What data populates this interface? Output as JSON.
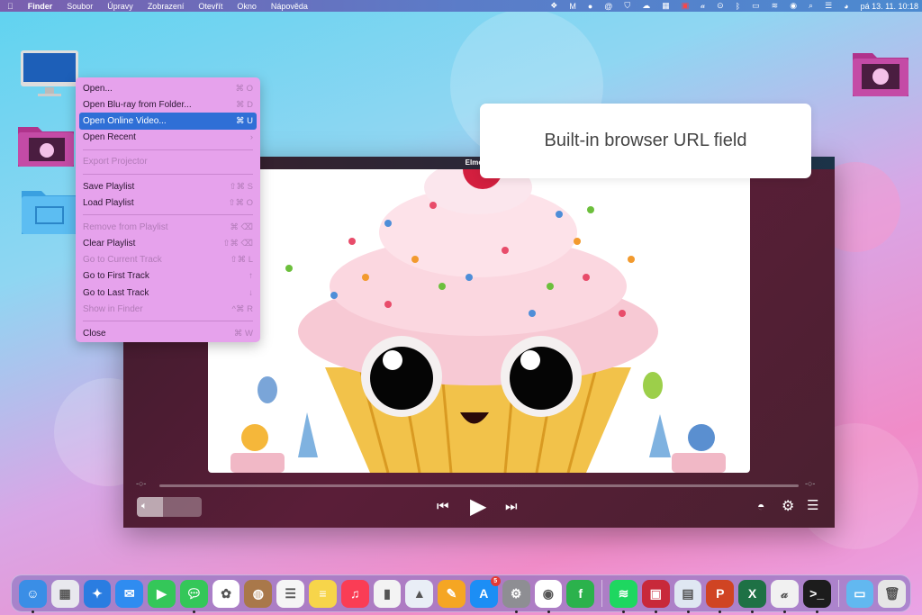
{
  "menubar": {
    "apple": "",
    "items": [
      "Finder",
      "Soubor",
      "Úpravy",
      "Zobrazení",
      "Otevřít",
      "Okno",
      "Nápověda"
    ],
    "clock": "pá 13. 11.  10:18"
  },
  "context_menu": {
    "items": [
      {
        "label": "Open...",
        "shortcut": "⌘ O",
        "state": "normal"
      },
      {
        "label": "Open Blu-ray from Folder...",
        "shortcut": "⌘ D",
        "state": "normal"
      },
      {
        "label": "Open Online Video...",
        "shortcut": "⌘ U",
        "state": "selected"
      },
      {
        "label": "Open Recent",
        "shortcut": "›",
        "state": "normal"
      },
      {
        "label": "Export Projector",
        "shortcut": "",
        "state": "disabled"
      },
      {
        "label": "Save Playlist",
        "shortcut": "⇧⌘ S",
        "state": "normal"
      },
      {
        "label": "Load Playlist",
        "shortcut": "⇧⌘ O",
        "state": "normal"
      },
      {
        "label": "Remove from Playlist",
        "shortcut": "⌘ ⌫",
        "state": "disabled"
      },
      {
        "label": "Clear Playlist",
        "shortcut": "⇧⌘ ⌫",
        "state": "normal"
      },
      {
        "label": "Go to Current Track",
        "shortcut": "⇧⌘ L",
        "state": "disabled"
      },
      {
        "label": "Go to First Track",
        "shortcut": "↑",
        "state": "normal"
      },
      {
        "label": "Go to Last Track",
        "shortcut": "↓",
        "state": "normal"
      },
      {
        "label": "Show in Finder",
        "shortcut": "^⌘ R",
        "state": "disabled"
      },
      {
        "label": "Close",
        "shortcut": "⌘ W",
        "state": "normal"
      }
    ]
  },
  "player": {
    "title": "Elmedia",
    "progress": 0,
    "volume": 0.4
  },
  "tooltip": "Built-in browser URL field",
  "dock": {
    "app_store_badge": "5",
    "apps": [
      "finder",
      "launchpad",
      "safari",
      "mail",
      "facetime",
      "messages",
      "photos",
      "contacts",
      "reminders",
      "notes",
      "music",
      "numbers",
      "keynote",
      "pages",
      "app-store",
      "system-preferences",
      "chrome",
      "feedly",
      "spotify",
      "parallels",
      "preview",
      "powerpoint",
      "excel",
      "script-editor",
      "terminal",
      "downloads-folder",
      "trash"
    ]
  },
  "colors": {
    "menu_bg": "#e6a2ec",
    "selected": "#2f6fd6",
    "player_bg": "#4a1e33"
  }
}
